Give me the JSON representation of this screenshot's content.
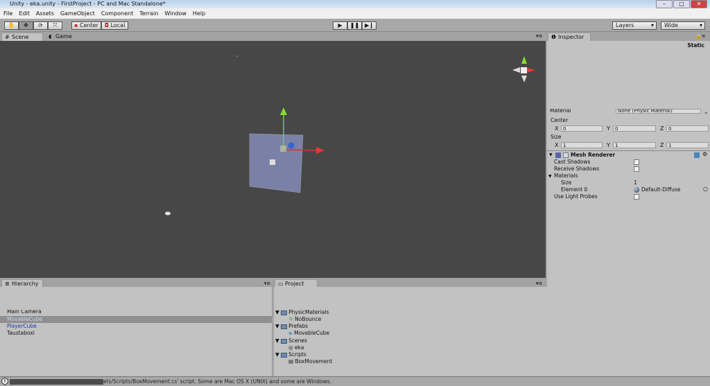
{
  "window": {
    "title": "Unity - eka.unity - FirstProject - PC and Mac Standalone*"
  },
  "menu": [
    "File",
    "Edit",
    "Assets",
    "GameObject",
    "Component",
    "Terrain",
    "Window",
    "Help"
  ],
  "toolbar": {
    "tools": [
      "hand",
      "move",
      "rotate",
      "scale"
    ],
    "pivot": "Center",
    "space": "Local",
    "layers": "Layers",
    "layout": "Wide"
  },
  "tabs": {
    "scene": "Scene",
    "game": "Game",
    "inspector": "Inspector",
    "hierarchy": "Hierarchy",
    "project": "Project"
  },
  "inspector": {
    "static": "Static",
    "material_label": "Material",
    "material_value": "None (Physic Material)",
    "center": {
      "label": "Center",
      "x": "0",
      "y": "0",
      "z": "0"
    },
    "size": {
      "label": "Size",
      "x": "1",
      "y": "1",
      "z": "1"
    },
    "axes": {
      "x": "X",
      "y": "Y",
      "z": "Z"
    },
    "mesh_renderer": {
      "title": "Mesh Renderer",
      "cast_shadows": "Cast Shadows",
      "receive_shadows": "Receive Shadows",
      "materials": "Materials",
      "size_label": "Size",
      "size_value": "1",
      "element0_label": "Element 0",
      "element0_value": "Default-Diffuse",
      "light_probes": "Use Light Probes"
    }
  },
  "hierarchy": [
    {
      "name": "Main Camera",
      "style": "normal"
    },
    {
      "name": "MovableCube",
      "style": "selected"
    },
    {
      "name": "PlayerCube",
      "style": "prefab"
    },
    {
      "name": "Taustaboxi",
      "style": "normal"
    }
  ],
  "project": [
    {
      "name": "PhysicMaterials",
      "type": "folder"
    },
    {
      "name": "NoBounce",
      "type": "physic"
    },
    {
      "name": "Prefabs",
      "type": "folder"
    },
    {
      "name": "MovableCube",
      "type": "prefab"
    },
    {
      "name": "Scenes",
      "type": "folder"
    },
    {
      "name": "eka",
      "type": "scene"
    },
    {
      "name": "Scripts",
      "type": "folder"
    },
    {
      "name": "BoxMovement",
      "type": "script"
    }
  ],
  "status": "ets/Scripts/BoxMovement.cs' script. Some are Mac OS X (UNIX) and some are Windows."
}
